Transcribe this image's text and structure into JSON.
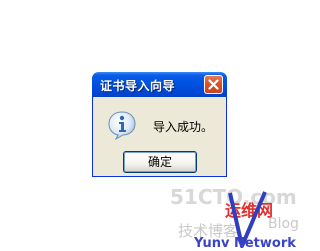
{
  "dialog": {
    "title": "证书导入向导",
    "message": "导入成功。",
    "ok_label": "确定"
  },
  "colors": {
    "titlebar": "#0054e3",
    "close": "#d9522a",
    "dialog_bg": "#ece9d8",
    "info_icon": "#2a6bb8"
  },
  "icons": {
    "info": "info-icon",
    "close": "close-icon"
  },
  "watermark": {
    "site": "51CTO.com",
    "tagline": "技术博客",
    "blog": "Blog",
    "chinese": "运维网",
    "network": "Yunv Network"
  }
}
